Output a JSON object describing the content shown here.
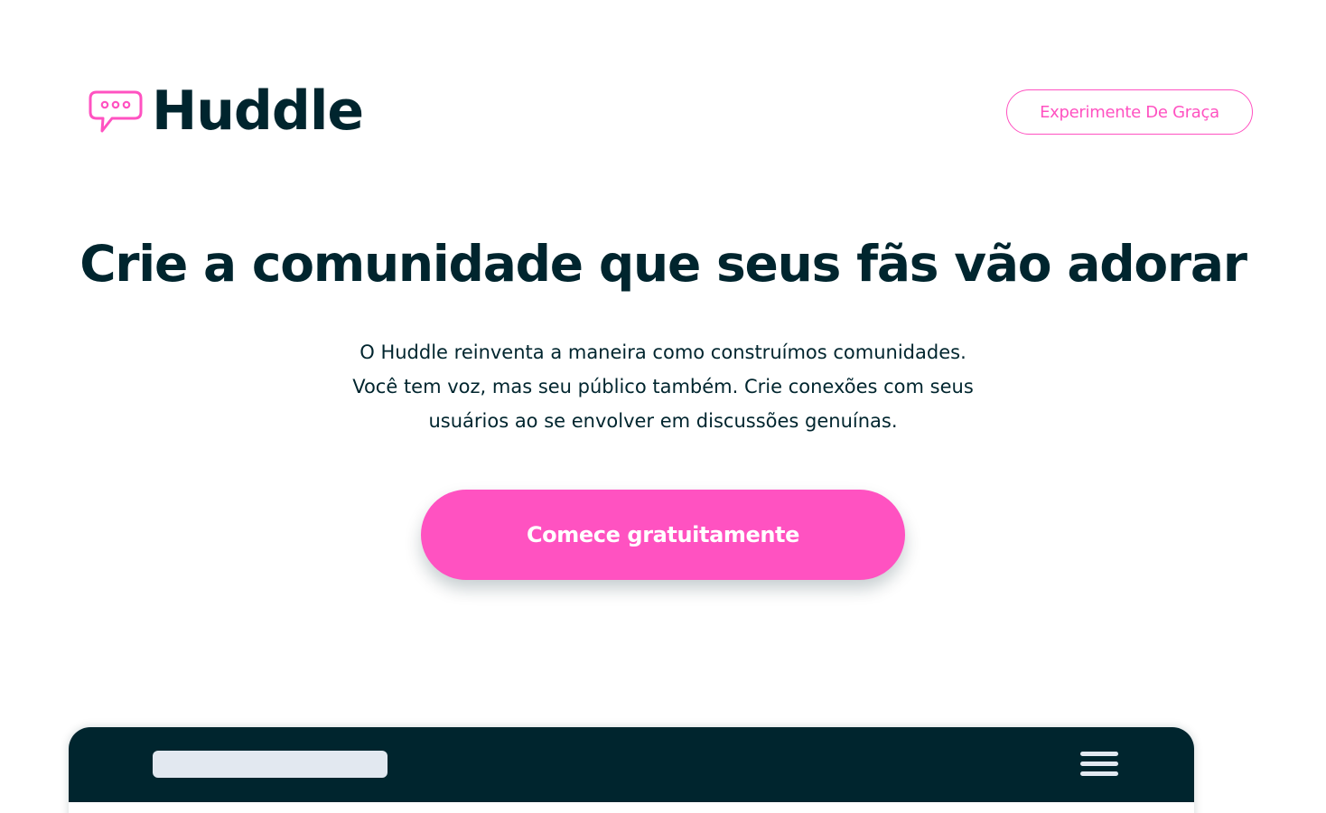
{
  "header": {
    "logo": {
      "text": "Huddle",
      "icon": "chat-bubble-icon",
      "icon_color": "#ff52c1"
    },
    "try_button_label": "Experimente De Graça"
  },
  "hero": {
    "title": "Crie a comunidade que seus fãs vão adorar",
    "description_lines": [
      "O Huddle reinventa a maneira como construímos comunidades.",
      "Você tem voz, mas seu público também. Crie conexões com seus",
      "usuários ao se envolver em discussões genuínas."
    ],
    "cta_label": "Comece gratuitamente"
  },
  "mockup": {
    "menu_icon": "hamburger-menu-icon"
  },
  "colors": {
    "accent": "#ff52c1",
    "dark": "#00252e",
    "placeholder": "#e2e8f0",
    "background": "#ffffff"
  }
}
